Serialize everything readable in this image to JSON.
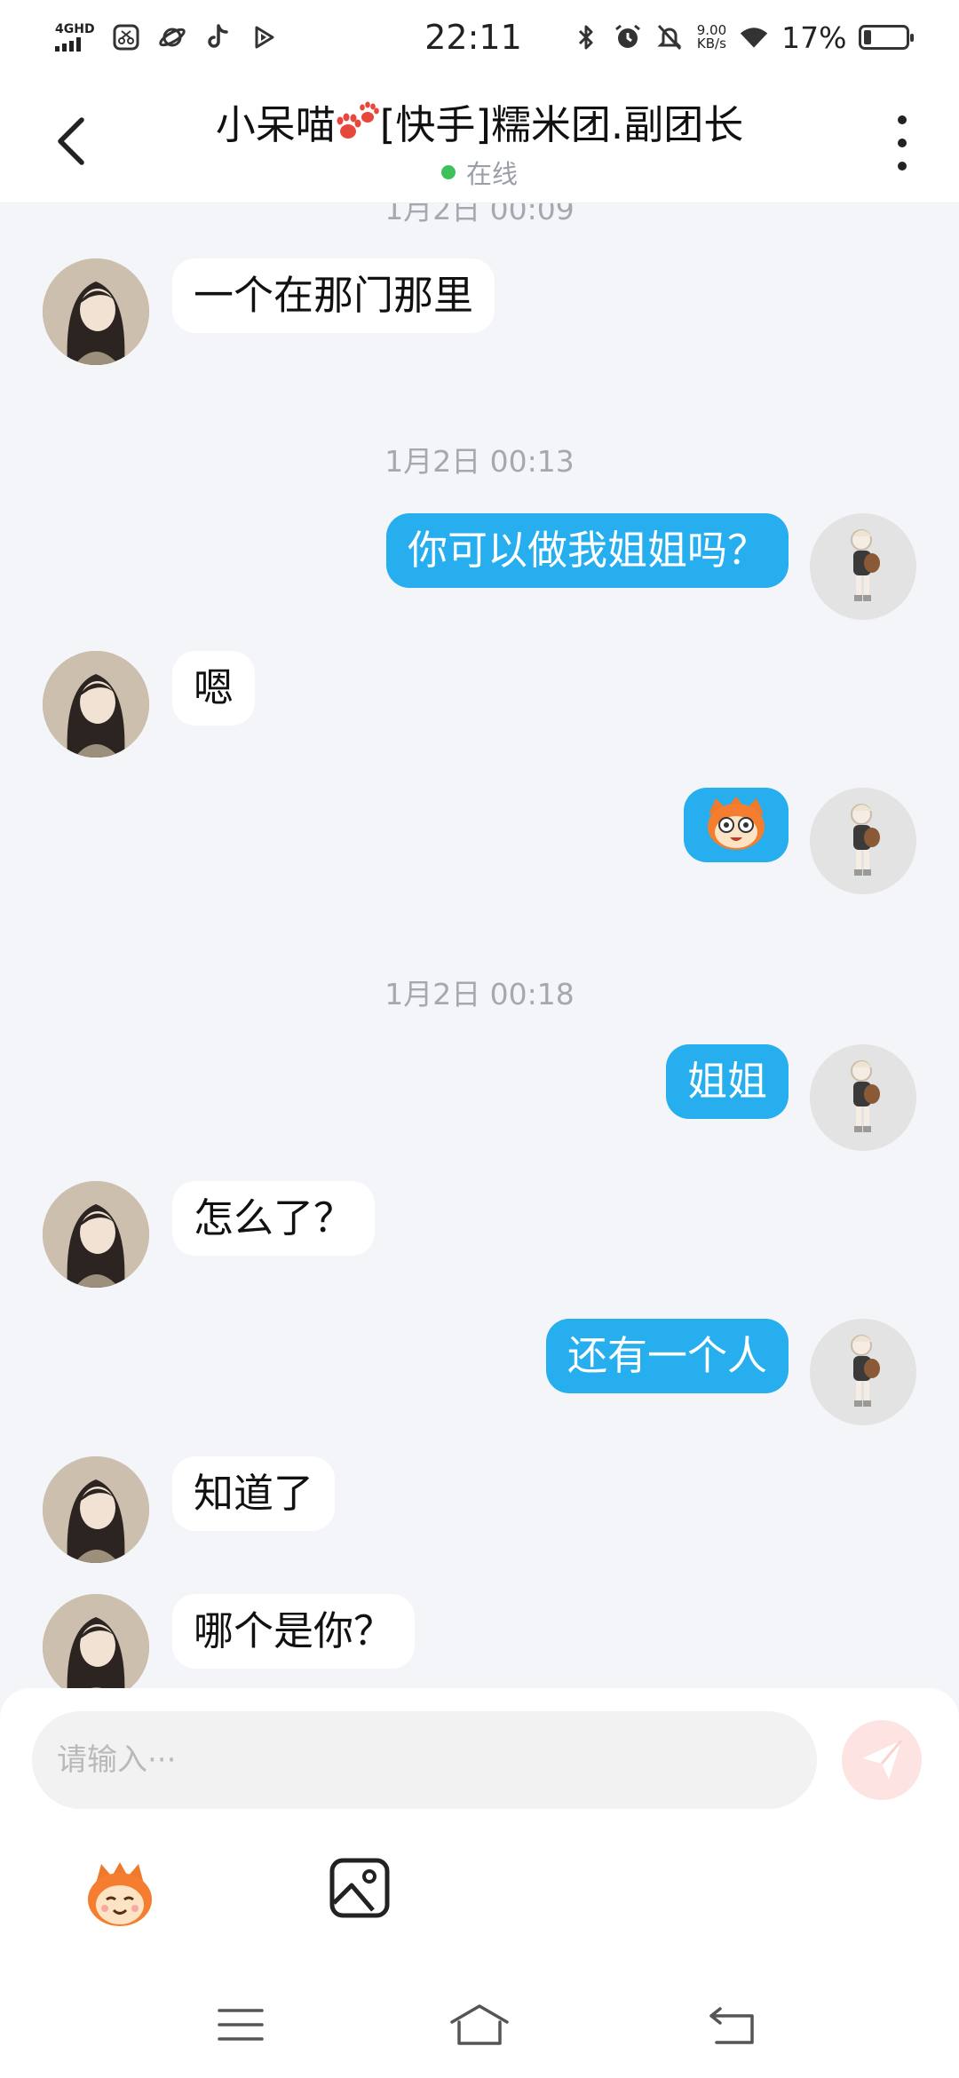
{
  "status_bar": {
    "network": "4GHD",
    "time": "22:11",
    "speed_value": "9.00",
    "speed_unit": "KB/s",
    "battery": "17%",
    "battery_level": 0.17,
    "icons": [
      "signal-icon",
      "scissors-app-icon",
      "planet-app-icon",
      "tiktok-icon",
      "play-app-icon",
      "bluetooth-icon",
      "alarm-icon",
      "mute-icon",
      "wifi-icon",
      "battery-icon"
    ]
  },
  "header": {
    "title_pre": "小呆喵",
    "title_post": "[快手]糯米团.副团长",
    "status": "在线",
    "status_color": "#3cc15b"
  },
  "chat": {
    "partial_timestamp": "1月2日 00:09",
    "timestamps": [
      "1月2日 00:13",
      "1月2日 00:18"
    ],
    "messages": [
      {
        "side": "left",
        "text": "一个在那门那里"
      },
      {
        "side": "right",
        "text": "你可以做我姐姐吗？"
      },
      {
        "side": "left",
        "text": "嗯"
      },
      {
        "side": "right",
        "text": "",
        "sticker": "cartoon-face-sticker"
      },
      {
        "side": "right",
        "text": "姐姐"
      },
      {
        "side": "left",
        "text": "怎么了？"
      },
      {
        "side": "right",
        "text": "还有一个人"
      },
      {
        "side": "left",
        "text": "知道了"
      },
      {
        "side": "left",
        "text": "哪个是你？"
      }
    ]
  },
  "composer": {
    "placeholder": "请输入···",
    "value": ""
  },
  "colors": {
    "accent": "#26aeef",
    "background": "#f3f5f8",
    "send": "#f46b5e"
  }
}
